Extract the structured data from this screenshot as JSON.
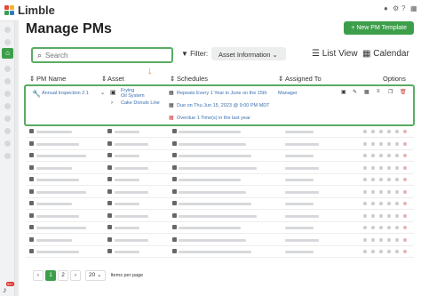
{
  "app": {
    "name": "Limble"
  },
  "page": {
    "title": "Manage PMs",
    "new_button": "+ New PM Template"
  },
  "toolbar": {
    "search_placeholder": "Search",
    "filter_label": "Filter:",
    "filter_value": "Asset Information",
    "view_list": "List View",
    "view_calendar": "Calendar"
  },
  "table": {
    "headers": {
      "pm_name": "PM Name",
      "asset": "Asset",
      "schedules": "Schedules",
      "assigned_to": "Assigned To",
      "options": "Options"
    },
    "highlight": {
      "pm_name": "Annual Inspection 2.1",
      "asset_parent": "Frying",
      "asset_parent_2": "Oil System",
      "asset_child": "Cake Donuts Line",
      "schedule_1": "Repeats Every 1 Year in June on the 15th",
      "schedule_2": "Due on Thu Jun 15, 2023 @ 9:00 PM MDT",
      "schedule_3": "Overdue 1 Time(s) in the last year",
      "assigned": "Manager"
    }
  },
  "pager": {
    "pages": [
      "1",
      "2"
    ],
    "per_page": "20",
    "per_page_label": "Items per page"
  },
  "icons": {
    "wrench": "wrench-icon",
    "calendar": "calendar-icon",
    "home": "home-icon",
    "bell": "bell-icon"
  },
  "colors": {
    "brand_green": "#3d9e4a",
    "link_blue": "#3b6fb0",
    "alert_red": "#d04040"
  }
}
